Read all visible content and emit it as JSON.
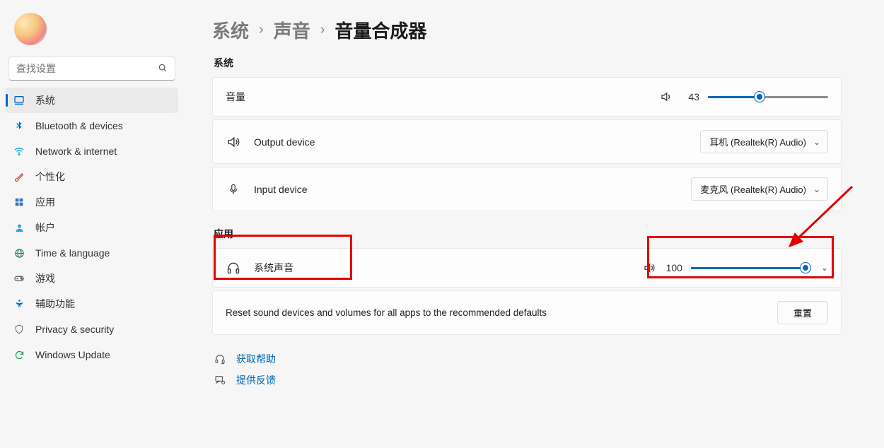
{
  "search": {
    "placeholder": "查找设置"
  },
  "sidebar": {
    "items": [
      {
        "label": "系统"
      },
      {
        "label": "Bluetooth & devices"
      },
      {
        "label": "Network & internet"
      },
      {
        "label": "个性化"
      },
      {
        "label": "应用"
      },
      {
        "label": "帐户"
      },
      {
        "label": "Time & language"
      },
      {
        "label": "游戏"
      },
      {
        "label": "辅助功能"
      },
      {
        "label": "Privacy & security"
      },
      {
        "label": "Windows Update"
      }
    ]
  },
  "breadcrumb": {
    "a": "系统",
    "b": "声音",
    "c": "音量合成器"
  },
  "sections": {
    "system": "系统",
    "apps": "应用"
  },
  "volume": {
    "label": "音量",
    "value": "43",
    "percent": 43
  },
  "outputDevice": {
    "label": "Output device",
    "selected": "耳机 (Realtek(R) Audio)"
  },
  "inputDevice": {
    "label": "Input device",
    "selected": "麦克风 (Realtek(R) Audio)"
  },
  "systemSound": {
    "label": "系统声音",
    "value": "100",
    "percent": 100
  },
  "reset": {
    "text": "Reset sound devices and volumes for all apps to the recommended defaults",
    "button": "重置"
  },
  "footer": {
    "help": "获取帮助",
    "feedback": "提供反馈"
  }
}
